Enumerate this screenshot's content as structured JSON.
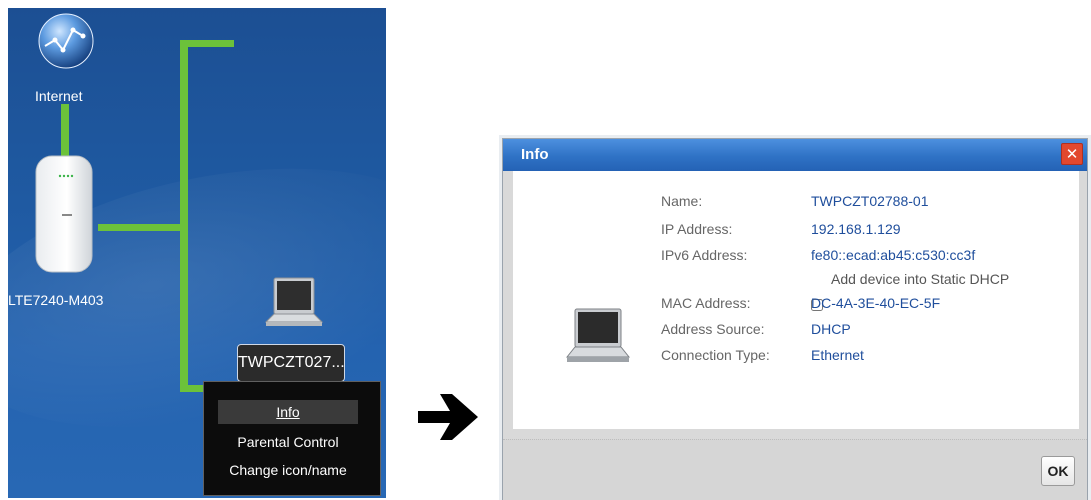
{
  "network_map": {
    "internet_label": "Internet",
    "router_label": "LTE7240-M403",
    "device_name": "TWPCZT027..."
  },
  "context_menu": {
    "items": [
      "Info",
      "Parental Control",
      "Change icon/name"
    ],
    "selected": "Info"
  },
  "dialog": {
    "title": "Info",
    "fields": [
      {
        "label": "Name:",
        "value": "TWPCZT02788-01"
      },
      {
        "label": "IP Address:",
        "value": "192.168.1.129"
      },
      {
        "label": "IPv6 Address:",
        "value": "fe80::ecad:ab45:c530:cc3f"
      },
      {
        "label": "MAC Address:",
        "value": "DC-4A-3E-40-EC-5F"
      },
      {
        "label": "Address Source:",
        "value": "DHCP"
      },
      {
        "label": "Connection Type:",
        "value": "Ethernet"
      }
    ],
    "static_dhcp_label": "Add device into Static DHCP",
    "static_dhcp_checked": false,
    "ok_label": "OK"
  },
  "colors": {
    "map_background": "#1f5aa2",
    "link_line": "#6cc23a",
    "dialog_title_bar": "#2f72c5",
    "value_text": "#1f4e9c",
    "close_button": "#e2482e"
  },
  "icons": [
    "globe-icon",
    "router-icon",
    "laptop-icon",
    "arrow-right-icon",
    "close-icon"
  ]
}
